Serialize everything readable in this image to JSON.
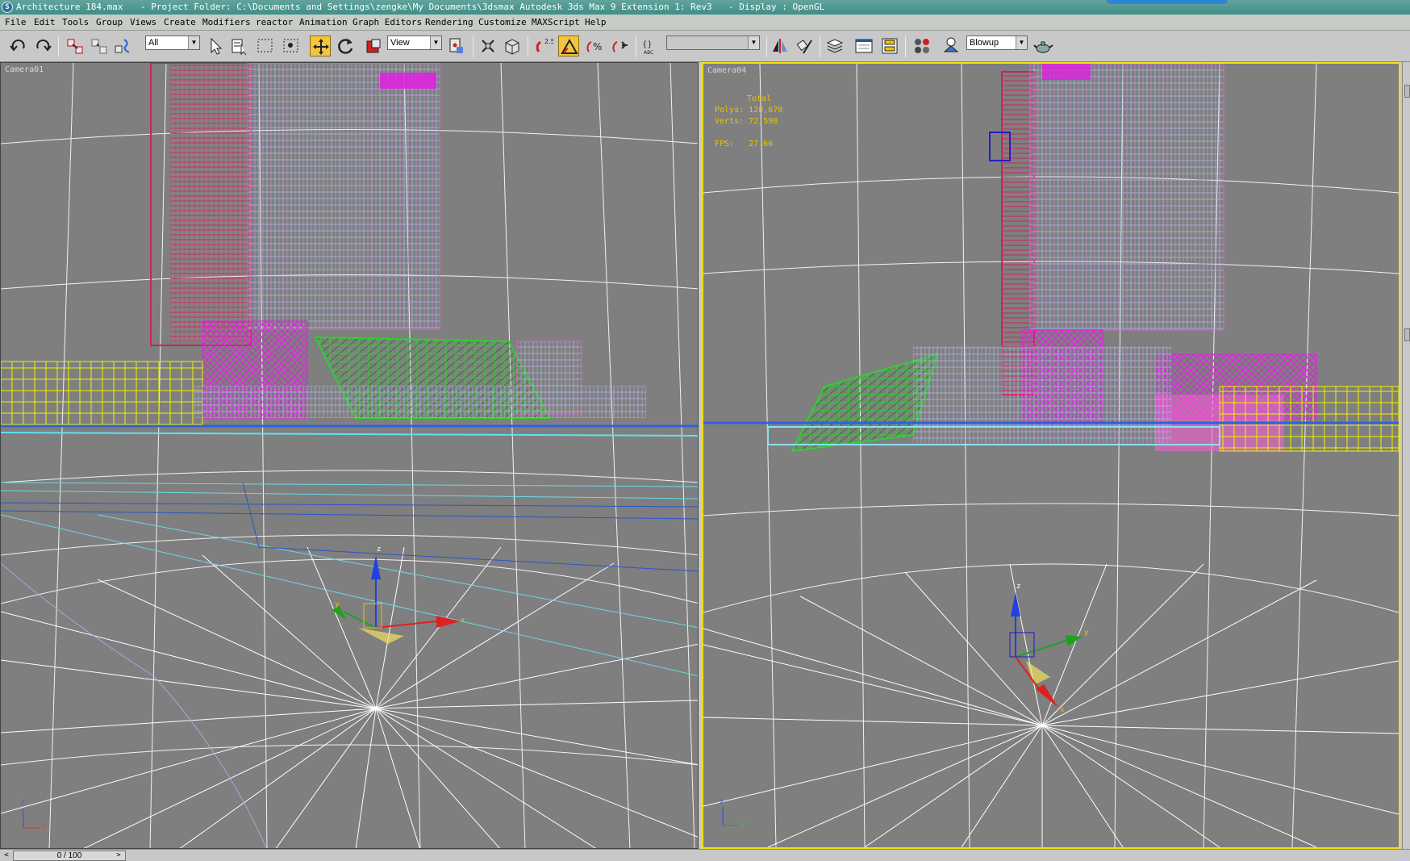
{
  "title_bar": {
    "file_name": "Architecture 184.max",
    "project_folder": "- Project Folder: C:\\Documents and Settings\\zengke\\My Documents\\3dsmax",
    "app_name": "- Autodesk 3ds Max 9 Extension 1: Rev3",
    "display": "- Display : OpenGL"
  },
  "menu": [
    "File",
    "Edit",
    "Tools",
    "Group",
    "Views",
    "Create",
    "Modifiers",
    "reactor",
    "Animation",
    "Graph Editors",
    "Rendering",
    "Customize",
    "MAXScript",
    "Help"
  ],
  "toolbar": {
    "selection_filter": "All",
    "reference_coord": "View",
    "named_selection": "",
    "render_preset": "Blowup",
    "icons": [
      "undo-icon",
      "redo-icon",
      "select-and-link-icon",
      "unlink-icon",
      "bind-to-spacewarp-icon",
      "select-object-icon",
      "select-by-name-icon",
      "rectangular-selection-icon",
      "window-crossing-icon",
      "select-and-move-icon",
      "select-and-rotate-icon",
      "select-and-scale-icon",
      "use-pivot-center-icon",
      "select-manipulate-icon",
      "keyboard-shortcut-override-icon",
      "snaps-toggle-icon",
      "angle-snap-icon",
      "percent-snap-icon",
      "spinner-snap-icon",
      "edit-named-selection-icon",
      "mirror-icon",
      "align-icon",
      "layer-manager-icon",
      "curve-editor-icon",
      "schematic-view-icon",
      "material-editor-icon",
      "render-setup-icon",
      "quick-render-icon"
    ]
  },
  "viewports": {
    "left": {
      "label": "Camera01"
    },
    "right": {
      "label": "Camera04",
      "stats": {
        "heading": "Total",
        "polys": "Polys: 128,670",
        "verts": "Verts: 72,598",
        "fps": "FPS:   27.66"
      }
    }
  },
  "axis_labels": {
    "x": "x",
    "y": "y",
    "z": "z"
  },
  "timeline": {
    "frame": "0 / 100",
    "prev": "<",
    "next": ">"
  },
  "colors": {
    "viewport_bg": "#7f7f7f",
    "active_border": "#f1e20a",
    "titlebar": "#4a9890",
    "grid": "#ffffff"
  }
}
